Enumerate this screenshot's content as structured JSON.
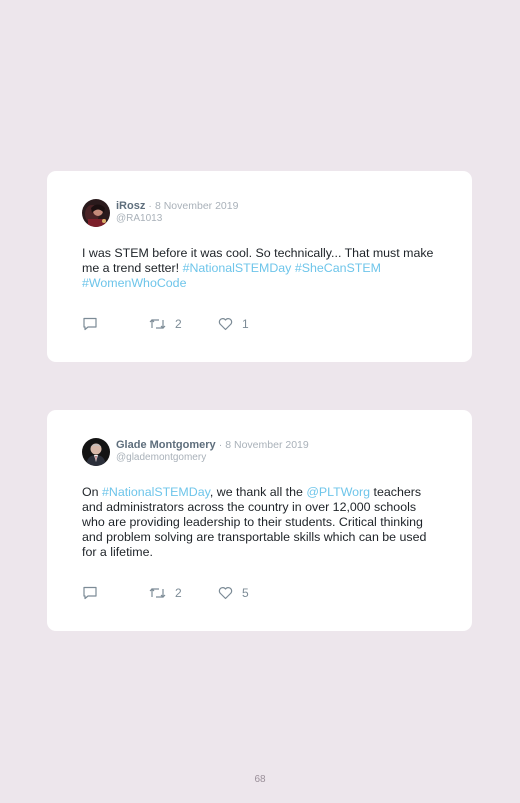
{
  "tweets": [
    {
      "name": "iRosz",
      "separator": "·",
      "date": "8 November 2019",
      "handle": "@RA1013",
      "text_parts": [
        {
          "text": "I was STEM before it was cool. So technically... That must make me a trend setter! ",
          "type": "text"
        },
        {
          "text": "#NationalSTEMDay",
          "type": "tag"
        },
        {
          "text": " ",
          "type": "text"
        },
        {
          "text": "#SheCanSTEM",
          "type": "tag"
        },
        {
          "text": " ",
          "type": "text"
        },
        {
          "text": "#WomenWhoCode",
          "type": "tag"
        }
      ],
      "retweets": "2",
      "likes": "1"
    },
    {
      "name": "Glade Montgomery",
      "separator": "·",
      "date": "8 November 2019",
      "handle": "@glademontgomery",
      "text_parts": [
        {
          "text": "On ",
          "type": "text"
        },
        {
          "text": "#NationalSTEMDay",
          "type": "tag"
        },
        {
          "text": ", we thank all the ",
          "type": "text"
        },
        {
          "text": "@PLTWorg",
          "type": "tag"
        },
        {
          "text": " teachers and administrators across the country in over 12,000 schools who are providing leadership to their students. Critical thinking and problem solving are transportable skills which can be used for a lifetime.",
          "type": "text"
        }
      ],
      "retweets": "2",
      "likes": "5"
    }
  ],
  "icons": {
    "reply": "reply-icon",
    "retweet": "retweet-icon",
    "like": "heart-icon"
  },
  "colors": {
    "background": "#ede6ec",
    "card": "#ffffff",
    "hashtag": "#6ec5ea",
    "name": "#5e6e7c",
    "muted": "#a9b1b9"
  },
  "page_number": "68"
}
